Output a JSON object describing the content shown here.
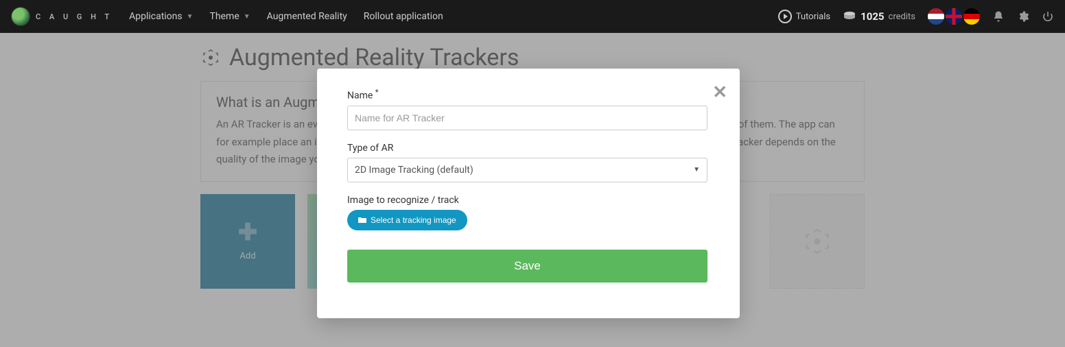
{
  "brand": "C A U G H T",
  "nav": {
    "applications": "Applications",
    "theme": "Theme",
    "ar": "Augmented Reality",
    "rollout": "Rollout application"
  },
  "right": {
    "tutorials": "Tutorials",
    "credits_num": "1025",
    "credits_label": "credits"
  },
  "page": {
    "title": "Augmented Reality Trackers",
    "info_title": "What is an Augmented Reality Tracker?",
    "info_text": "An AR Tracker is an event page with an image attached. The app will recognize the image and render things on top of them. The app can for example place an image, a video or even a 3D model onto the tracker. The ability of the app to recognize your Tracker depends on the quality of the image you upload.",
    "add_label": "Add"
  },
  "modal": {
    "name_label": "Name",
    "name_required_marker": "*",
    "name_placeholder": "Name for AR Tracker",
    "type_label": "Type of AR",
    "type_value": "2D Image Tracking (default)",
    "image_label": "Image to recognize / track",
    "select_image_btn": "Select a tracking image",
    "save": "Save"
  }
}
